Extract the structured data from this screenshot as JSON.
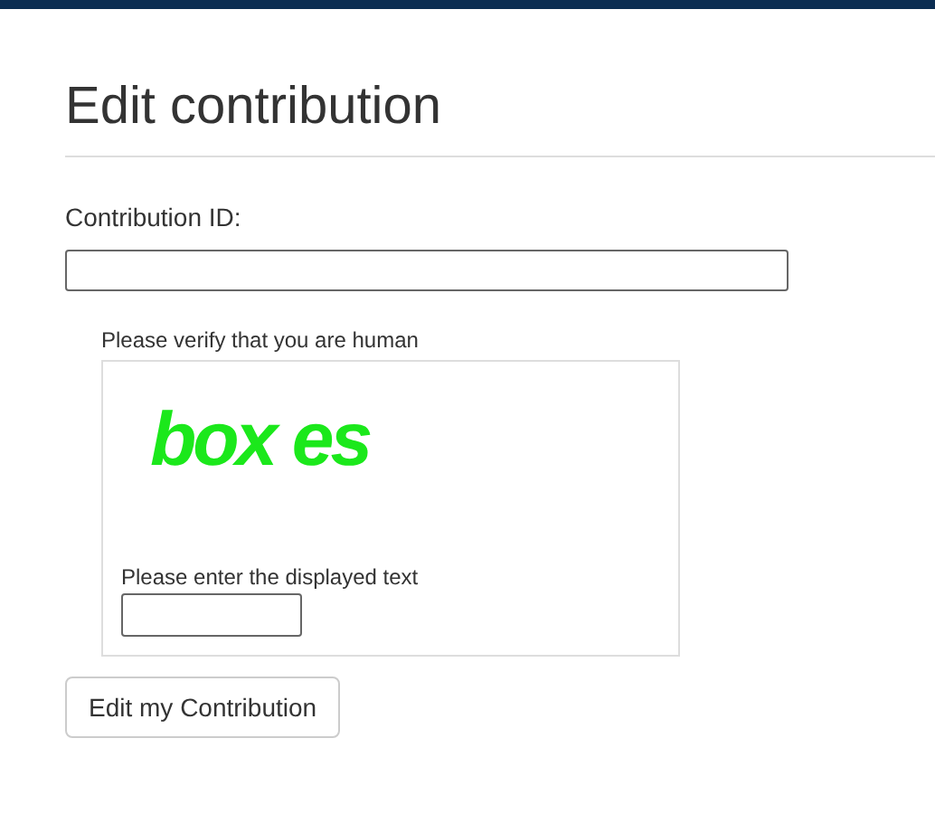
{
  "page": {
    "title": "Edit contribution"
  },
  "form": {
    "id_label": "Contribution ID:",
    "captcha": {
      "prompt": "Please verify that you are human",
      "image_text": "box es",
      "entry_label": "Please enter the displayed text"
    },
    "submit": "Edit my Contribution"
  }
}
